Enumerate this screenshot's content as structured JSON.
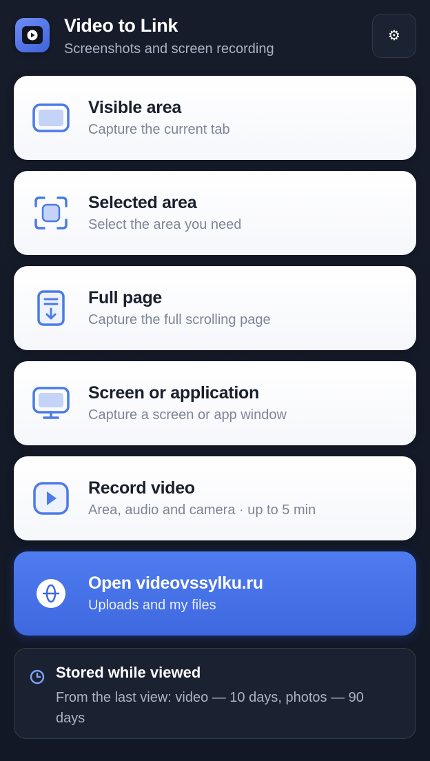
{
  "header": {
    "title": "Video to Link",
    "subtitle": "Screenshots and screen recording",
    "settings_icon": "⚙"
  },
  "actions": [
    {
      "icon": "visible-area-icon",
      "title": "Visible area",
      "subtitle": "Capture the current tab"
    },
    {
      "icon": "selected-area-icon",
      "title": "Selected area",
      "subtitle": "Select the area you need"
    },
    {
      "icon": "full-page-icon",
      "title": "Full page",
      "subtitle": "Capture the full scrolling page"
    },
    {
      "icon": "monitor-icon",
      "title": "Screen or application",
      "subtitle": "Capture a screen or app window"
    },
    {
      "icon": "play-icon",
      "title": "Record video",
      "subtitle": "Area, audio and camera · up to 5 min"
    },
    {
      "icon": "globe-icon",
      "title": "Open videovssylku.ru",
      "subtitle": "Uploads and my files"
    }
  ],
  "info": {
    "icon": "clock-icon",
    "title": "Stored while viewed",
    "text": "From the last view: video — 10 days, photos — 90 days"
  },
  "colors": {
    "background": "#151b28",
    "accent": "#4a75ea",
    "icon_blue": "#4a7be8"
  }
}
